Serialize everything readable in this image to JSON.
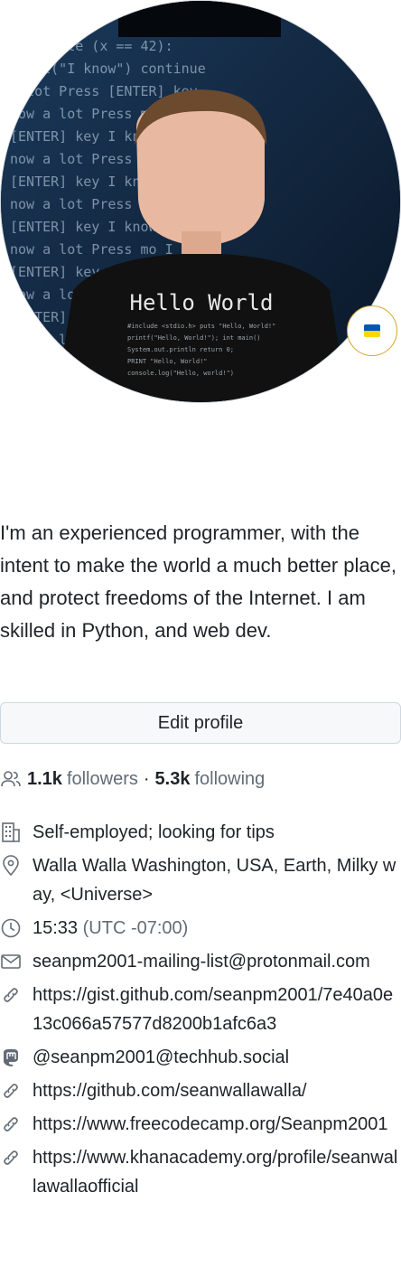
{
  "profile": {
    "avatar_shirt_text": "Hello World",
    "status_badge": {
      "icon": "ukraine-flag",
      "flag_colors": [
        "#0057b7",
        "#ffd700"
      ]
    },
    "bio": "I'm an experienced programmer, with the intent to make the world a much better place, and protect freedoms of the Internet. I am skilled in Python, and web dev.",
    "edit_label": "Edit profile",
    "followers_count": "1.1k",
    "followers_label": "followers",
    "separator": "·",
    "following_count": "5.3k",
    "following_label": "following",
    "company": "Self-employed; looking for tips",
    "location": "Walla Walla Washington, USA, Earth, Milky way, <Universe>",
    "local_time": "15:33",
    "timezone": "(UTC -07:00)",
    "email": "seanpm2001-mailing-list@protonmail.com",
    "links": [
      "https://gist.github.com/seanpm2001/7e40a0e13c066a57577d8200b1afc6a3",
      "https://github.com/seanwallawalla/",
      "https://www.freecodecamp.org/Seanpm2001",
      "https://www.khanacademy.org/profile/seanwallawallaofficial"
    ],
    "mastodon": "@seanpm2001@techhub.social"
  },
  "colors": {
    "text": "#1f2328",
    "muted": "#636c76",
    "border": "#d0d7de",
    "button_bg": "#f6f8fa",
    "badge_border": "#d4a72c"
  }
}
